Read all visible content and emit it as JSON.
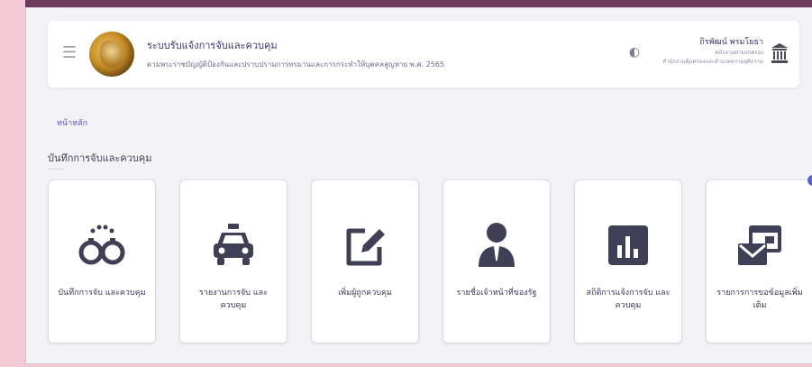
{
  "header": {
    "app_title": "ระบบรับแจ้งการจับและควบคุม",
    "app_subtitle": "ตามพระราชบัญญัติป้องกันและปราบปรามการทรมานและการกระทำให้บุคคลสูญหาย พ.ศ. 2565",
    "user_name": "ถิรพัฒน์ พรมโยธา",
    "user_role": "พนักงานฝ่ายปกครอง",
    "user_org": "สำนักงานคุ้มครองและอำนวยความยุติธรรม"
  },
  "breadcrumb": "หน้าหลัก",
  "section": {
    "title": "บันทึกการจับและควบคุม",
    "subtitle": "———"
  },
  "cards": [
    {
      "label": "บันทึกการจับ และควบคุม",
      "icon": "handcuffs-icon"
    },
    {
      "label": "รายงานการจับ และควบคุม",
      "icon": "police-car-icon"
    },
    {
      "label": "เพิ่มผู้ถูกควบคุม",
      "icon": "edit-icon"
    },
    {
      "label": "รายชื่อเจ้าหน้าที่ของรัฐ",
      "icon": "officer-icon"
    },
    {
      "label": "สถิติการแจ้งการจับ และควบคุม",
      "icon": "chart-icon"
    },
    {
      "label": "รายการการขอข้อมูลเพิ่มเติม",
      "icon": "mail-window-icon"
    }
  ],
  "colors": {
    "accent": "#5a4fb0",
    "icon": "#3f3f55",
    "background": "#f3f3f6"
  }
}
